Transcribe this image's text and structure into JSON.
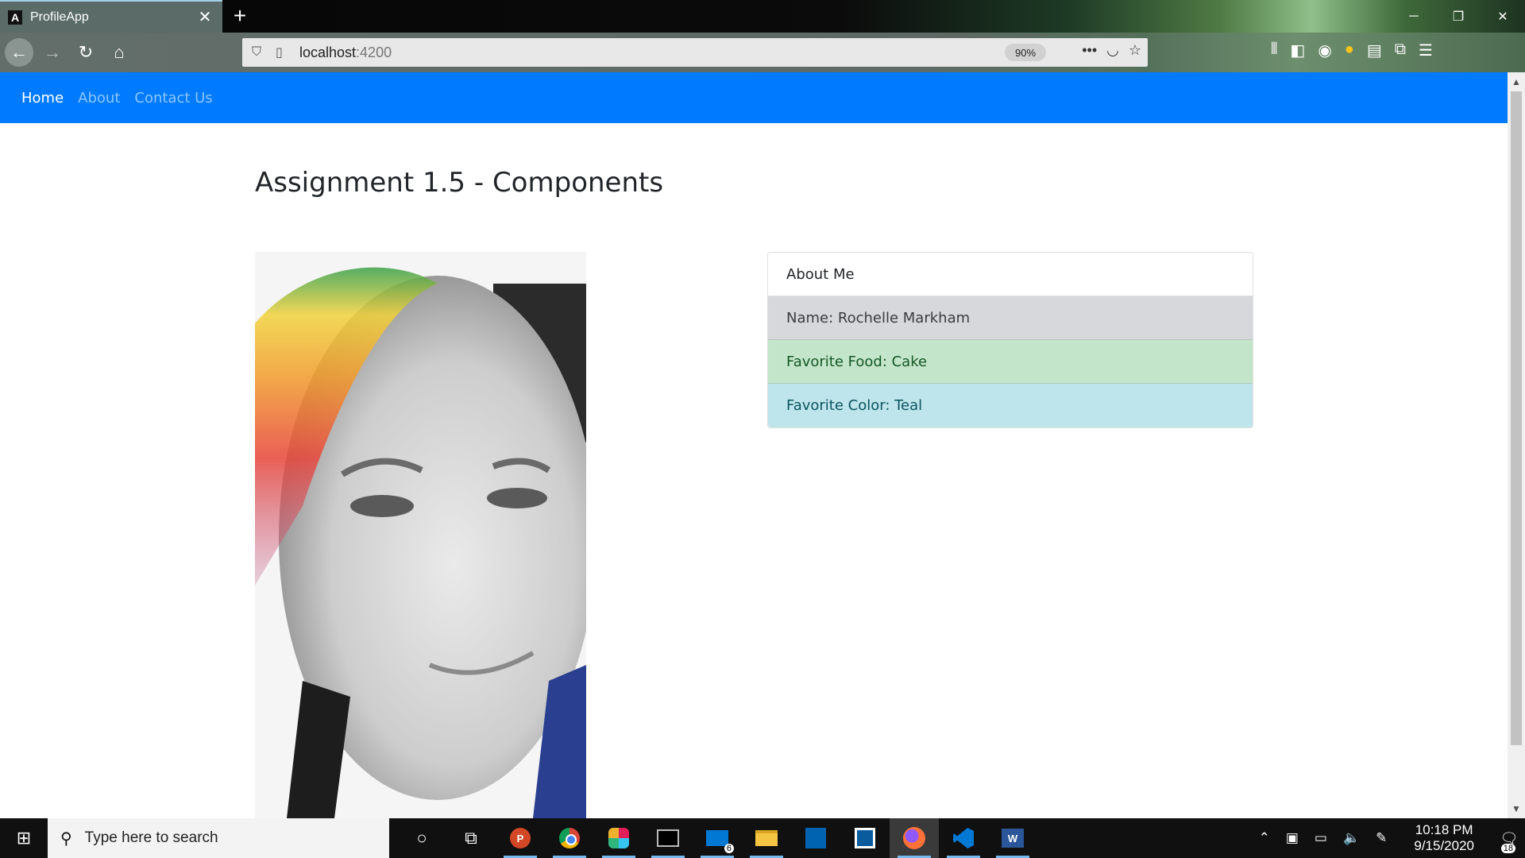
{
  "browser": {
    "tab_title": "ProfileApp",
    "tab_favicon": "A",
    "new_tab_label": "+",
    "url_host": "localhost",
    "url_port": ":4200",
    "zoom": "90%"
  },
  "navbar": {
    "links": [
      {
        "label": "Home",
        "active": true
      },
      {
        "label": "About",
        "active": false
      },
      {
        "label": "Contact Us",
        "active": false
      }
    ]
  },
  "main": {
    "title": "Assignment 1.5 - Components",
    "card": {
      "header": "About Me",
      "items": [
        {
          "text": "Name: Rochelle Markham",
          "style": "secondary"
        },
        {
          "text": "Favorite Food: Cake",
          "style": "success"
        },
        {
          "text": "Favorite Color: Teal",
          "style": "info"
        }
      ]
    }
  },
  "taskbar": {
    "search_placeholder": "Type here to search",
    "mail_badge": "6",
    "time": "10:18 PM",
    "date": "9/15/2020",
    "notifications": "18"
  },
  "colors": {
    "navbar_bg": "#007bff",
    "list_secondary": "#d6d8db",
    "list_success": "#c3e6cb",
    "list_info": "#bee5eb"
  }
}
